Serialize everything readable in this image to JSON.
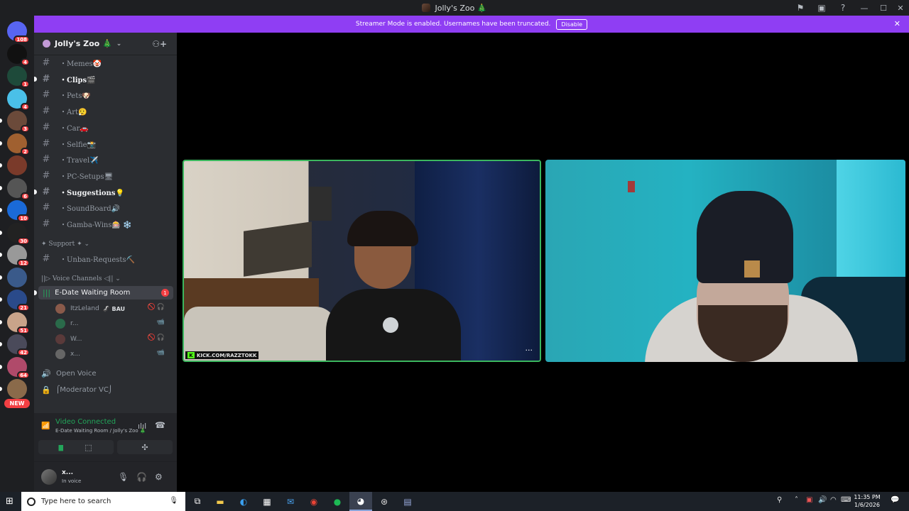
{
  "window": {
    "title": "Jolly's Zoo 🎄"
  },
  "banner": {
    "message": "Streamer Mode is enabled. Usernames have been truncated.",
    "button": "Disable"
  },
  "rail": {
    "servers": [
      {
        "badge": "108",
        "color": "#5865f2"
      },
      {
        "badge": "4",
        "color": "#111111"
      },
      {
        "badge": "1",
        "color": "#1e4a3a"
      },
      {
        "badge": "4",
        "color": "#4ac0e8"
      },
      {
        "badge": "3",
        "color": "#6b4a3a"
      },
      {
        "badge": "2",
        "color": "#a06030"
      },
      {
        "badge": "",
        "color": "#7a3a2a"
      },
      {
        "badge": "6",
        "color": "#555555"
      },
      {
        "badge": "10",
        "color": "#1a6ad8"
      },
      {
        "badge": "30",
        "color": "#222222"
      },
      {
        "badge": "12",
        "color": "#999999"
      },
      {
        "badge": "",
        "color": "#3a5a8a"
      },
      {
        "badge": "21",
        "color": "#2a4a8a"
      },
      {
        "badge": "51",
        "color": "#c9a48a"
      },
      {
        "badge": "42",
        "color": "#4a4a5a"
      },
      {
        "badge": "64",
        "color": "#b04a6a"
      },
      {
        "badge": "",
        "color": "#8a6a4a"
      }
    ],
    "new_label": "NEW"
  },
  "server": {
    "name": "Jolly's Zoo 🎄"
  },
  "channels": [
    {
      "name": "・Memes🤡",
      "bold": false
    },
    {
      "name": "・Clips🎬",
      "bold": true
    },
    {
      "name": "・Pets🐶",
      "bold": false
    },
    {
      "name": "・Art😮‍💨",
      "bold": false
    },
    {
      "name": "・Car🚗",
      "bold": false
    },
    {
      "name": "・Selfie📸",
      "bold": false
    },
    {
      "name": "・Travel✈️",
      "bold": false
    },
    {
      "name": "・PC-Setups🖥",
      "bold": false
    },
    {
      "name": "・Suggestions💡",
      "bold": true
    },
    {
      "name": "・SoundBoard🔊",
      "bold": false
    },
    {
      "name": "・Gamba-Wins🎰 ❄️",
      "bold": false
    }
  ],
  "support": {
    "category": "✦ Support ✦ ⌄",
    "channel": "・Unban-Requests⛏️"
  },
  "voice": {
    "category": "||▷ Voice Channels ◁|| ⌄",
    "active_channel": "E-Date Waiting Room",
    "active_badge": "1",
    "users": [
      {
        "name": "ItzLeland",
        "extra": "🦨 BAU",
        "icons": "🚫🎧",
        "color": "#8a5a4a"
      },
      {
        "name": "r...",
        "extra": "",
        "icons": "📹",
        "color": "#2a6a4a"
      },
      {
        "name": "W...",
        "extra": "",
        "icons": "🚫🎧",
        "color": "#5a3a3a"
      },
      {
        "name": "x...",
        "extra": "",
        "icons": "📹",
        "color": "#666666"
      }
    ],
    "open_voice": "Open Voice",
    "moderator_vc": "⌠Moderator VC⌡"
  },
  "voice_panel": {
    "status": "Video Connected",
    "location": "E-Date Waiting Room / Jolly's Zoo 🎄"
  },
  "user_panel": {
    "name": "x...",
    "status": "In voice"
  },
  "stage": {
    "tile1_tag": "KICK.COM/RAZZTOKK"
  },
  "taskbar": {
    "search_placeholder": "Type here to search",
    "time": "11:35 PM",
    "date": "1/6/2026"
  }
}
